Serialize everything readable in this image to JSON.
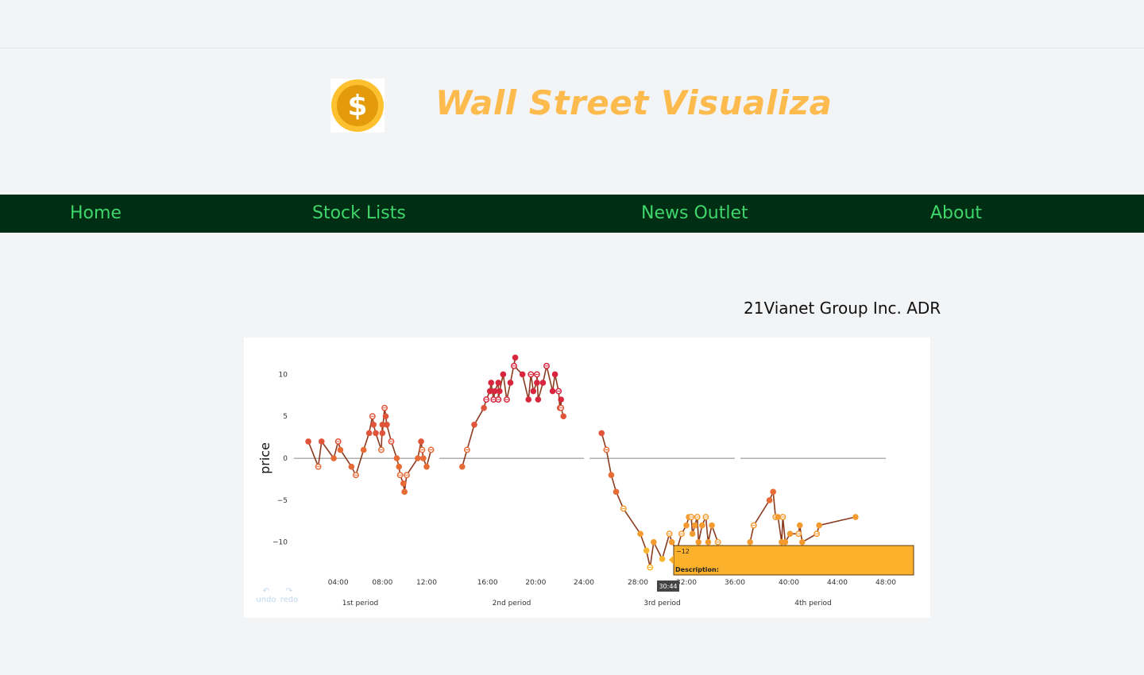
{
  "header": {
    "title": "Wall Street Visualiza",
    "logo": {
      "icon": "dollar-coin-icon",
      "glyph": "$"
    }
  },
  "nav": {
    "items": [
      {
        "label": "Home"
      },
      {
        "label": "Stock Lists"
      },
      {
        "label": "News Outlet"
      },
      {
        "label": "About"
      }
    ]
  },
  "stock": {
    "name": "21Vianet Group Inc. ADR"
  },
  "controls": {
    "undo_label": "undo",
    "redo_label": "redo",
    "undo_icon": "undo-icon",
    "redo_icon": "redo-icon"
  },
  "colors": {
    "nav_bg": "#002e14",
    "nav_text": "#3ed66a",
    "title": "#fdba4d",
    "line": "#8b3b1f",
    "tooltip": "#fbb12b"
  },
  "chart_data": {
    "type": "line",
    "ylabel": "price",
    "ylim": [
      -14,
      12.5
    ],
    "yticks": [
      10,
      5,
      0,
      -5,
      -10
    ],
    "periods": [
      {
        "name": "1st period",
        "xlim": [
          0,
          12
        ],
        "ticks": [
          "04:00",
          "08:00",
          "12:00"
        ],
        "tick_values": [
          4,
          8,
          12
        ],
        "values": [
          [
            1.3,
            2
          ],
          [
            2.2,
            -1
          ],
          [
            2.5,
            2
          ],
          [
            3.6,
            0
          ],
          [
            4,
            2
          ],
          [
            4.2,
            1
          ],
          [
            5.2,
            -1
          ],
          [
            5.6,
            -2
          ],
          [
            6.3,
            1
          ],
          [
            6.8,
            3
          ],
          [
            7.1,
            5
          ],
          [
            7.2,
            4
          ],
          [
            7.4,
            3
          ],
          [
            7.9,
            1
          ],
          [
            8,
            4
          ],
          [
            8,
            3
          ],
          [
            8.2,
            6
          ],
          [
            8.3,
            5
          ],
          [
            8.4,
            4
          ],
          [
            8.8,
            2
          ],
          [
            9.3,
            0
          ],
          [
            9.5,
            -1
          ],
          [
            9.6,
            -2
          ],
          [
            9.9,
            -3
          ],
          [
            10,
            -4
          ],
          [
            10.2,
            -2
          ],
          [
            11.2,
            0
          ],
          [
            11.5,
            2
          ],
          [
            11.6,
            1
          ],
          [
            11.7,
            0
          ],
          [
            12,
            -1
          ],
          [
            12.4,
            1
          ]
        ]
      },
      {
        "name": "2nd period",
        "xlim": [
          12,
          24
        ],
        "ticks": [
          "16:00",
          "20:00",
          "24:00"
        ],
        "tick_values": [
          16,
          20,
          24
        ],
        "values": [
          [
            13.9,
            -1
          ],
          [
            14.3,
            1
          ],
          [
            14.9,
            4
          ],
          [
            15.7,
            6
          ],
          [
            15.9,
            7
          ],
          [
            16.2,
            8
          ],
          [
            16.3,
            9
          ],
          [
            16.5,
            7
          ],
          [
            16.6,
            8
          ],
          [
            16.9,
            9
          ],
          [
            16.9,
            7
          ],
          [
            17,
            8
          ],
          [
            17.3,
            10
          ],
          [
            17.6,
            7
          ],
          [
            17.9,
            9
          ],
          [
            18.3,
            12
          ],
          [
            18.2,
            11
          ],
          [
            18.9,
            10
          ],
          [
            19.4,
            7
          ],
          [
            19.6,
            10
          ],
          [
            19.8,
            8
          ],
          [
            20.1,
            9
          ],
          [
            20.1,
            10
          ],
          [
            20.2,
            7
          ],
          [
            20.6,
            9
          ],
          [
            20.9,
            11
          ],
          [
            21.4,
            8
          ],
          [
            21.6,
            10
          ],
          [
            21.9,
            8
          ],
          [
            22,
            6
          ],
          [
            22.1,
            7
          ],
          [
            22.1,
            6
          ],
          [
            22.3,
            5
          ]
        ]
      },
      {
        "name": "3rd period",
        "xlim": [
          24,
          36
        ],
        "ticks": [
          "28:00",
          "32:00",
          "36:00"
        ],
        "tick_values": [
          28,
          32,
          36
        ],
        "values": [
          [
            25,
            3
          ],
          [
            25.4,
            1
          ],
          [
            25.8,
            -2
          ],
          [
            26.2,
            -4
          ],
          [
            26.8,
            -6
          ],
          [
            28.2,
            -9
          ],
          [
            28.7,
            -11
          ],
          [
            29,
            -13
          ],
          [
            29.3,
            -10
          ],
          [
            30,
            -12
          ],
          [
            30.6,
            -9
          ],
          [
            30.8,
            -10
          ],
          [
            31.2,
            -11
          ],
          [
            31.6,
            -9
          ],
          [
            32,
            -8
          ],
          [
            32.2,
            -7
          ],
          [
            32.4,
            -7
          ],
          [
            32.5,
            -9
          ],
          [
            32.7,
            -8
          ],
          [
            32.9,
            -7
          ],
          [
            33,
            -10
          ],
          [
            33.3,
            -8
          ],
          [
            33.6,
            -7
          ],
          [
            33.8,
            -10
          ],
          [
            34.1,
            -8
          ],
          [
            34.6,
            -10
          ]
        ]
      },
      {
        "name": "4th period",
        "xlim": [
          36,
          48
        ],
        "ticks": [
          "40:00",
          "44:00",
          "48:00"
        ],
        "tick_values": [
          40,
          44,
          48
        ],
        "values": [
          [
            36.8,
            -10
          ],
          [
            37.1,
            -8
          ],
          [
            38.4,
            -5
          ],
          [
            38.7,
            -4
          ],
          [
            38.9,
            -7
          ],
          [
            39.1,
            -7
          ],
          [
            39.4,
            -10
          ],
          [
            39.5,
            -7
          ],
          [
            39.7,
            -10
          ],
          [
            40.1,
            -9
          ],
          [
            40.8,
            -9
          ],
          [
            40.9,
            -8
          ],
          [
            41.1,
            -10
          ],
          [
            42.3,
            -9
          ],
          [
            42.5,
            -8
          ],
          [
            45.5,
            -7
          ]
        ]
      }
    ],
    "hover": {
      "x_label": "30:44",
      "value": "−12",
      "description_label": "Description:"
    },
    "grid": false,
    "legend": "none"
  }
}
